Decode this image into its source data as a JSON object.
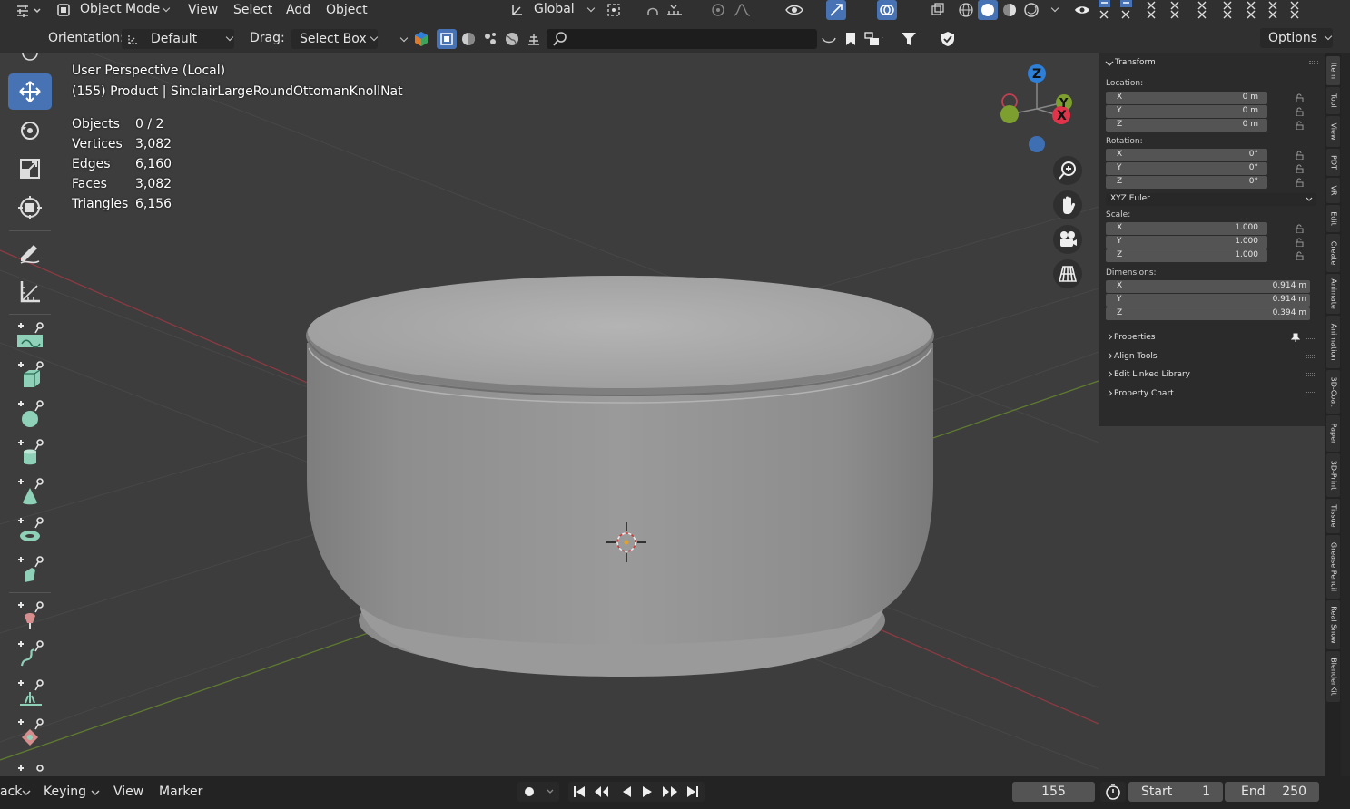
{
  "header": {
    "mode_label": "Object Mode",
    "menus": [
      "View",
      "Select",
      "Add",
      "Object"
    ],
    "transform_orientation": "Global",
    "orientation_label": "Orientation:",
    "orientation_value": "Default",
    "drag_label": "Drag:",
    "drag_value": "Select Box",
    "options_label": "Options"
  },
  "viewport": {
    "view_name": "User Perspective (Local)",
    "object_info": "(155) Product | SinclairLargeRoundOttomanKnollNat",
    "stats": [
      {
        "label": "Objects",
        "value": "0 / 2"
      },
      {
        "label": "Vertices",
        "value": "3,082"
      },
      {
        "label": "Edges",
        "value": "6,160"
      },
      {
        "label": "Faces",
        "value": "3,082"
      },
      {
        "label": "Triangles",
        "value": "6,156"
      }
    ],
    "gizmo": {
      "z": "Z",
      "y": "Y",
      "x": "X"
    }
  },
  "npanel": {
    "title": "Transform",
    "location_label": "Location:",
    "location": [
      {
        "axis": "X",
        "value": "0 m"
      },
      {
        "axis": "Y",
        "value": "0 m"
      },
      {
        "axis": "Z",
        "value": "0 m"
      }
    ],
    "rotation_label": "Rotation:",
    "rotation": [
      {
        "axis": "X",
        "value": "0°"
      },
      {
        "axis": "Y",
        "value": "0°"
      },
      {
        "axis": "Z",
        "value": "0°"
      }
    ],
    "rotation_mode": "XYZ Euler",
    "scale_label": "Scale:",
    "scale": [
      {
        "axis": "X",
        "value": "1.000"
      },
      {
        "axis": "Y",
        "value": "1.000"
      },
      {
        "axis": "Z",
        "value": "1.000"
      }
    ],
    "dimensions_label": "Dimensions:",
    "dimensions": [
      {
        "axis": "X",
        "value": "0.914 m"
      },
      {
        "axis": "Y",
        "value": "0.914 m"
      },
      {
        "axis": "Z",
        "value": "0.394 m"
      }
    ],
    "sections": [
      "Properties",
      "Align Tools",
      "Edit Linked Library",
      "Property Chart"
    ]
  },
  "side_tabs": [
    "Item",
    "Tool",
    "View",
    "PDT",
    "VR",
    "Edit",
    "Create",
    "Animate",
    "Animation",
    "3D-Coat",
    "Paper",
    "3D-Print",
    "Tissue",
    "Grease Pencil",
    "Real Snow",
    "BlenderKit"
  ],
  "timeline": {
    "menus": [
      "ack",
      "Keying",
      "View",
      "Marker"
    ],
    "current_frame": "155",
    "start_label": "Start",
    "start_value": "1",
    "end_label": "End",
    "end_value": "250"
  }
}
